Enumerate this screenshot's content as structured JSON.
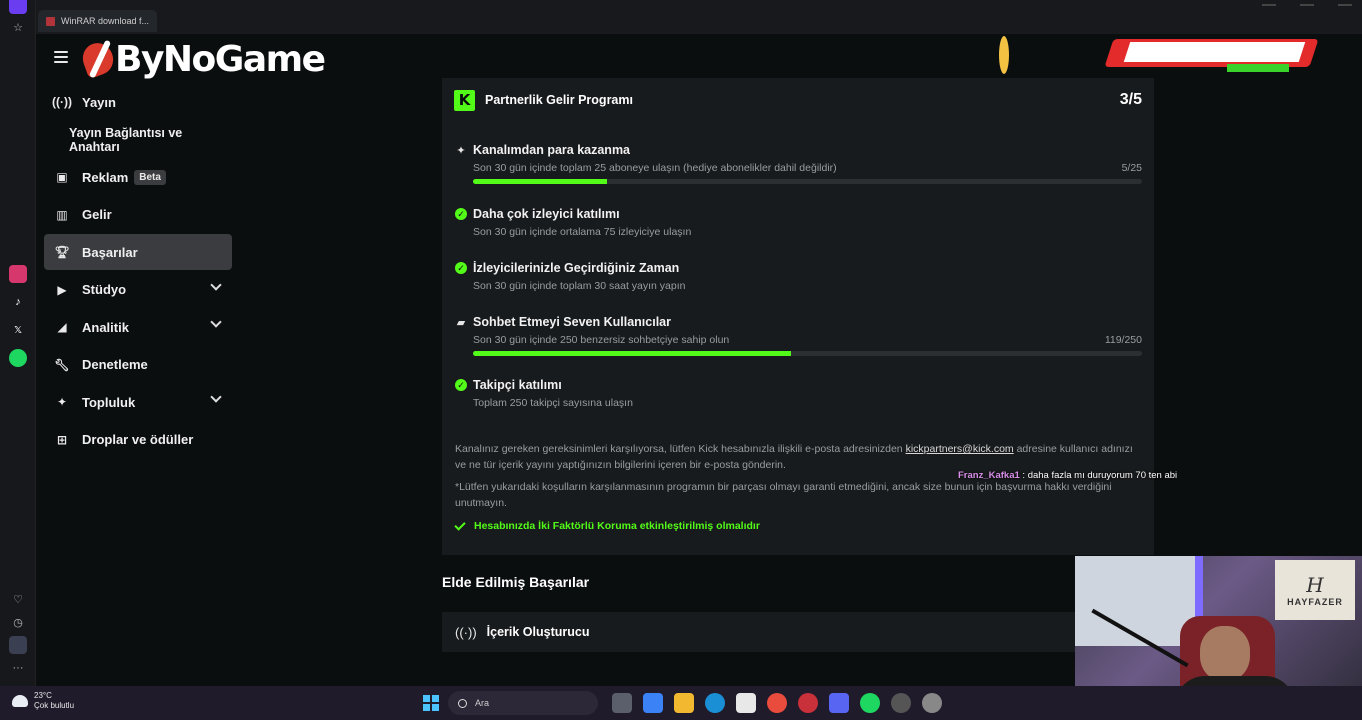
{
  "browser": {
    "tab_title": "WinRAR download f...",
    "opera_sidebar_icons": [
      "opera-icon",
      "star-icon",
      "instagram-icon",
      "tiktok-icon",
      "x-icon",
      "spotify-icon",
      "heart-icon",
      "clock-icon",
      "box-icon",
      "more-icon"
    ]
  },
  "header": {
    "logo_text": "ByNoGame"
  },
  "sidebar": {
    "items": [
      {
        "label": "Yayın",
        "icon": "broadcast-icon"
      },
      {
        "label": "Yayın Bağlantısı ve Anahtarı",
        "icon": ""
      },
      {
        "label": "Reklam",
        "icon": "ad-icon",
        "badge": "Beta"
      },
      {
        "label": "Gelir",
        "icon": "chart-icon"
      },
      {
        "label": "Başarılar",
        "icon": "trophy-icon",
        "active": true
      },
      {
        "label": "Stüdyo",
        "icon": "video-icon",
        "expandable": true
      },
      {
        "label": "Analitik",
        "icon": "analytics-icon",
        "expandable": true
      },
      {
        "label": "Denetleme",
        "icon": "wrench-icon"
      },
      {
        "label": "Topluluk",
        "icon": "community-icon",
        "expandable": true
      },
      {
        "label": "Droplar ve ödüller",
        "icon": "gift-icon"
      }
    ]
  },
  "program": {
    "title": "Partnerlik Gelir Programı",
    "count": "3/5",
    "requirements": [
      {
        "title": "Kanalımdan para kazanma",
        "description": "Son 30 gün içinde toplam 25 aboneye ulaşın (hediye abonelikler dahil değildir)",
        "progress_text": "5/25",
        "progress": 0.2,
        "completed": false
      },
      {
        "title": "Daha çok izleyici katılımı",
        "description": "Son 30 gün içinde ortalama 75 izleyiciye ulaşın",
        "completed": true
      },
      {
        "title": "İzleyicilerinizle Geçirdiğiniz Zaman",
        "description": "Son 30 gün içinde toplam 30 saat yayın yapın",
        "completed": true
      },
      {
        "title": "Sohbet Etmeyi Seven Kullanıcılar",
        "description": "Son 30 gün içinde 250 benzersiz sohbetçiye sahip olun",
        "progress_text": "119/250",
        "progress": 0.476,
        "completed": false
      },
      {
        "title": "Takipçi katılımı",
        "description": "Toplam 250 takipçi sayısına ulaşın",
        "completed": true
      }
    ],
    "info_text_1": "Kanalınız gereken gereksinimleri karşılıyorsa, lütfen Kick hesabınızla ilişkili e-posta adresinizden",
    "info_link": "kickpartners@kick.com",
    "info_text_2": "adresine kullanıcı adınızı ve ne tür içerik yayını yaptığınızın bilgilerini içeren bir e-posta gönderin.",
    "info_note": "*Lütfen yukarıdaki koşulların karşılanmasının programın bir parçası olmayı garanti etmediğini, ancak size bunun için başvurma hakkı verdiğini unutmayın.",
    "twofa_text": "Hesabınızda İki Faktörlü Koruma etkinleştirilmiş olmalıdır"
  },
  "earned": {
    "section_title": "Elde Edilmiş Başarılar",
    "items": [
      {
        "label": "İçerik Oluşturucu",
        "icon": "broadcast-icon"
      }
    ]
  },
  "chat_overlay": {
    "user": "Franz_Kafka1",
    "message": ": daha fazla mı duruyorum 70 ten abi"
  },
  "webcam": {
    "poster_letter": "H",
    "poster_name": "HAYFAZER"
  },
  "taskbar": {
    "temperature": "23°C",
    "weather": "Çok bulutlu",
    "search_placeholder": "Ara"
  },
  "colors": {
    "accent": "#53fc18",
    "card_bg": "#181b1d",
    "page_bg": "#0b0e0f"
  }
}
